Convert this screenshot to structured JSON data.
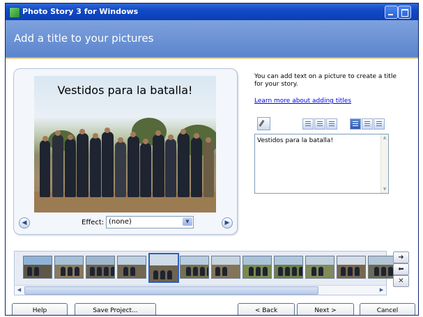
{
  "window": {
    "title": "Photo Story 3 for Windows"
  },
  "header": {
    "title": "Add a title to your pictures"
  },
  "preview": {
    "overlay_title": "Vestidos para la batalla!",
    "effect_label": "Effect:",
    "effect_value": "(none)"
  },
  "right_panel": {
    "description": "You can add text on a picture to create a title for your story.",
    "learn_more_link": "Learn more about adding titles",
    "text_value": "Vestidos para la batalla!"
  },
  "filmstrip": {
    "selected_index": 4,
    "thumbnails": [
      {
        "sky": "#8fb3d6",
        "ground": "#5e5748"
      },
      {
        "sky": "#a6c0d8",
        "ground": "#8a7a5a"
      },
      {
        "sky": "#9fb7cc",
        "ground": "#6a6252"
      },
      {
        "sky": "#bcd0e0",
        "ground": "#736652"
      },
      {
        "sky": "#cfdbe6",
        "ground": "#6f6450"
      },
      {
        "sky": "#b7cde0",
        "ground": "#77704f"
      },
      {
        "sky": "#c6d4e0",
        "ground": "#827559"
      },
      {
        "sky": "#a9c2d8",
        "ground": "#7a8a4e"
      },
      {
        "sky": "#b0c8dc",
        "ground": "#6f7f47"
      },
      {
        "sky": "#c0d0de",
        "ground": "#808a5a"
      },
      {
        "sky": "#d4dde6",
        "ground": "#78674f"
      },
      {
        "sky": "#b4c6d6",
        "ground": "#6d6a55"
      }
    ]
  },
  "side_controls": {
    "move_right": "➜",
    "move_left": "⬅",
    "remove": "✕"
  },
  "buttons": {
    "help": "Help",
    "save_project": "Save Project...",
    "back": "< Back",
    "next": "Next >",
    "cancel": "Cancel"
  },
  "colors": {
    "titlebar": "#1149c7",
    "header": "#6a90d4",
    "header_accent": "#e3ae3e",
    "selection": "#2d5fbf",
    "link": "#0000ee"
  },
  "icons": {
    "app": "photo-story-app-icon",
    "nav_previous": "circle-arrow-left-icon",
    "nav_next": "circle-arrow-right-icon",
    "font": "pen-font-icon",
    "dropdown": "chevron-down-icon"
  }
}
